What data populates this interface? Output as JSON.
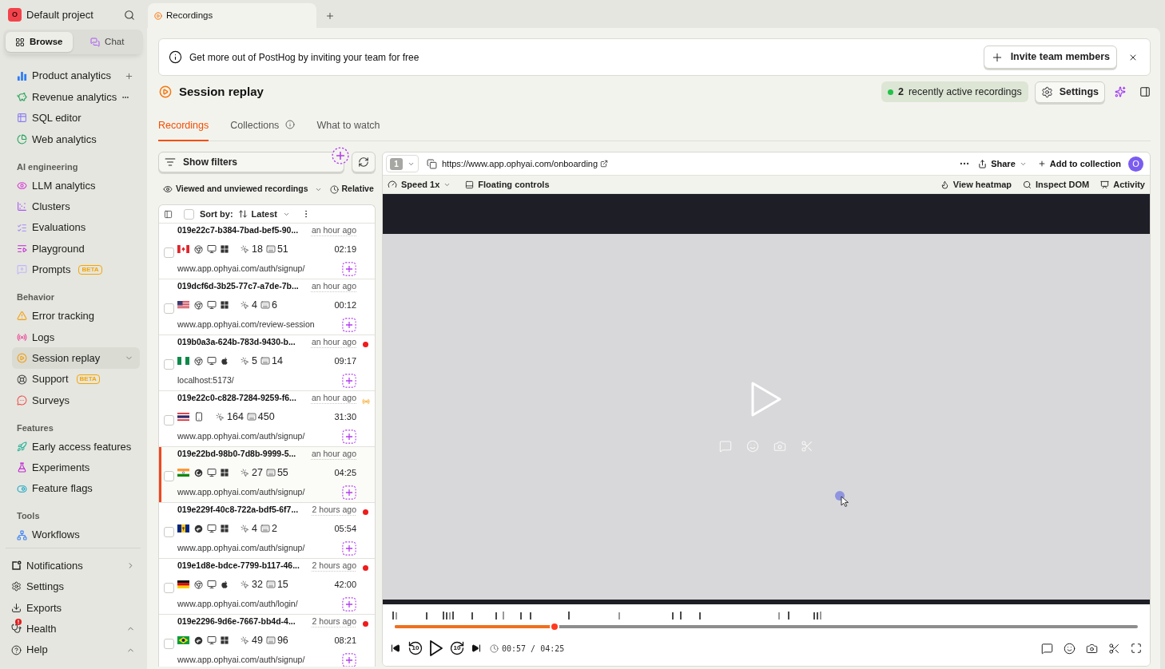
{
  "sidebar": {
    "project": {
      "avatar": "O",
      "name": "Default project"
    },
    "modes": [
      {
        "label": "Browse",
        "selected": true
      },
      {
        "label": "Chat",
        "selected": false
      }
    ],
    "sections": [
      {
        "items": [
          {
            "label": "Product analytics",
            "selected": false,
            "kind": "add"
          },
          {
            "label": "Revenue analytics",
            "selected": false,
            "kind": "more"
          },
          {
            "label": "SQL editor",
            "selected": false,
            "kind": "plain"
          },
          {
            "label": "Web analytics",
            "selected": false,
            "kind": "plain"
          }
        ]
      },
      {
        "heading": "AI engineering",
        "items": [
          {
            "label": "LLM analytics",
            "selected": false,
            "kind": "plain"
          },
          {
            "label": "Clusters",
            "selected": false,
            "kind": "plain"
          },
          {
            "label": "Evaluations",
            "selected": false,
            "kind": "plain"
          },
          {
            "label": "Playground",
            "selected": false,
            "kind": "plain"
          },
          {
            "label": "Prompts",
            "selected": false,
            "kind": "plain",
            "badge": "BETA"
          }
        ]
      },
      {
        "heading": "Behavior",
        "items": [
          {
            "label": "Error tracking",
            "selected": false,
            "kind": "plain"
          },
          {
            "label": "Logs",
            "selected": false,
            "kind": "plain"
          },
          {
            "label": "Session replay",
            "selected": true,
            "kind": "expandable"
          },
          {
            "label": "Support",
            "selected": false,
            "kind": "plain",
            "badge": "BETA"
          },
          {
            "label": "Surveys",
            "selected": false,
            "kind": "plain"
          }
        ]
      },
      {
        "heading": "Features",
        "items": [
          {
            "label": "Early access features",
            "selected": false,
            "kind": "plain"
          },
          {
            "label": "Experiments",
            "selected": false,
            "kind": "plain"
          },
          {
            "label": "Feature flags",
            "selected": false,
            "kind": "plain"
          }
        ]
      },
      {
        "heading": "Tools",
        "items": [
          {
            "label": "Workflows",
            "selected": false,
            "kind": "plain"
          }
        ]
      }
    ],
    "footer": [
      {
        "label": "Notifications",
        "kind": "submenu",
        "alert": false
      },
      {
        "label": "Settings",
        "kind": "plain",
        "alert": false
      },
      {
        "label": "Exports",
        "kind": "plain",
        "alert": false
      },
      {
        "label": "Health",
        "kind": "popup",
        "alert": true
      },
      {
        "label": "Help",
        "kind": "popup",
        "alert": false
      }
    ]
  },
  "page_tabs": [
    {
      "label": "Recordings",
      "selected": true
    }
  ],
  "banner": {
    "text": "Get more out of PostHog by inviting your team for free",
    "button": "Invite team members"
  },
  "header": {
    "title": "Session replay",
    "active_count": "2",
    "active_label": "recently active recordings",
    "settings": "Settings"
  },
  "tabs": [
    {
      "label": "Recordings",
      "selected": true,
      "info": false
    },
    {
      "label": "Collections",
      "selected": false,
      "info": true
    },
    {
      "label": "What to watch",
      "selected": false,
      "info": false
    }
  ],
  "filters": {
    "button": "Show filters",
    "visibility": "Viewed and unviewed recordings",
    "date_range": "Relative"
  },
  "list": {
    "select_all_checked": false,
    "sort_label": "Sort by:",
    "sort_value": "Latest",
    "recordings": [
      {
        "id": "019e22c7-b384-7bad-bef5-90...",
        "time": "an hour ago",
        "kind": "viewed",
        "clicks": "18",
        "keystrokes": "51",
        "duration": "02:19",
        "url": "www.app.ophyai.com/auth/signup/",
        "checked": false,
        "selected": false
      },
      {
        "id": "019dcf6d-3b25-77c7-a7de-7b...",
        "time": "an hour ago",
        "kind": "viewed",
        "clicks": "4",
        "keystrokes": "6",
        "duration": "00:12",
        "url": "www.app.ophyai.com/review-session",
        "checked": false,
        "selected": false
      },
      {
        "id": "019b0a3a-624b-783d-9430-b...",
        "time": "an hour ago",
        "kind": "unviewed",
        "clicks": "5",
        "keystrokes": "14",
        "duration": "09:17",
        "url": "localhost:5173/",
        "checked": false,
        "selected": false
      },
      {
        "id": "019e22c0-c828-7284-9259-f6...",
        "time": "an hour ago",
        "kind": "live",
        "clicks": "164",
        "keystrokes": "450",
        "duration": "31:30",
        "url": "www.app.ophyai.com/auth/signup/",
        "checked": false,
        "selected": false
      },
      {
        "id": "019e22bd-98b0-7d8b-9999-5...",
        "time": "an hour ago",
        "kind": "viewed",
        "clicks": "27",
        "keystrokes": "55",
        "duration": "04:25",
        "url": "www.app.ophyai.com/auth/signup/",
        "checked": false,
        "selected": true
      },
      {
        "id": "019e229f-40c8-722a-bdf5-6f7...",
        "time": "2 hours ago",
        "kind": "unviewed",
        "clicks": "4",
        "keystrokes": "2",
        "duration": "05:54",
        "url": "www.app.ophyai.com/auth/signup/",
        "checked": false,
        "selected": false
      },
      {
        "id": "019e1d8e-bdce-7799-b117-46...",
        "time": "2 hours ago",
        "kind": "unviewed",
        "clicks": "32",
        "keystrokes": "15",
        "duration": "42:00",
        "url": "www.app.ophyai.com/auth/login/",
        "checked": false,
        "selected": false
      },
      {
        "id": "019e2296-9d6e-7667-bb4d-4...",
        "time": "2 hours ago",
        "kind": "unviewed",
        "clicks": "49",
        "keystrokes": "96",
        "duration": "08:21",
        "url": "www.app.ophyai.com/auth/signup/",
        "checked": false,
        "selected": false
      }
    ]
  },
  "player": {
    "window": "1",
    "url": "https://www.app.ophyai.com/onboarding",
    "share": "Share",
    "collection": "Add to collection",
    "avatar": "O",
    "speed": "Speed 1x",
    "floating": "Floating controls",
    "tools": [
      "View heatmap",
      "Inspect DOM",
      "Activity"
    ],
    "progress": {
      "level": 0.215
    },
    "seek_back": "10",
    "seek_forward": "10",
    "time": "00:57 / 04:25"
  }
}
